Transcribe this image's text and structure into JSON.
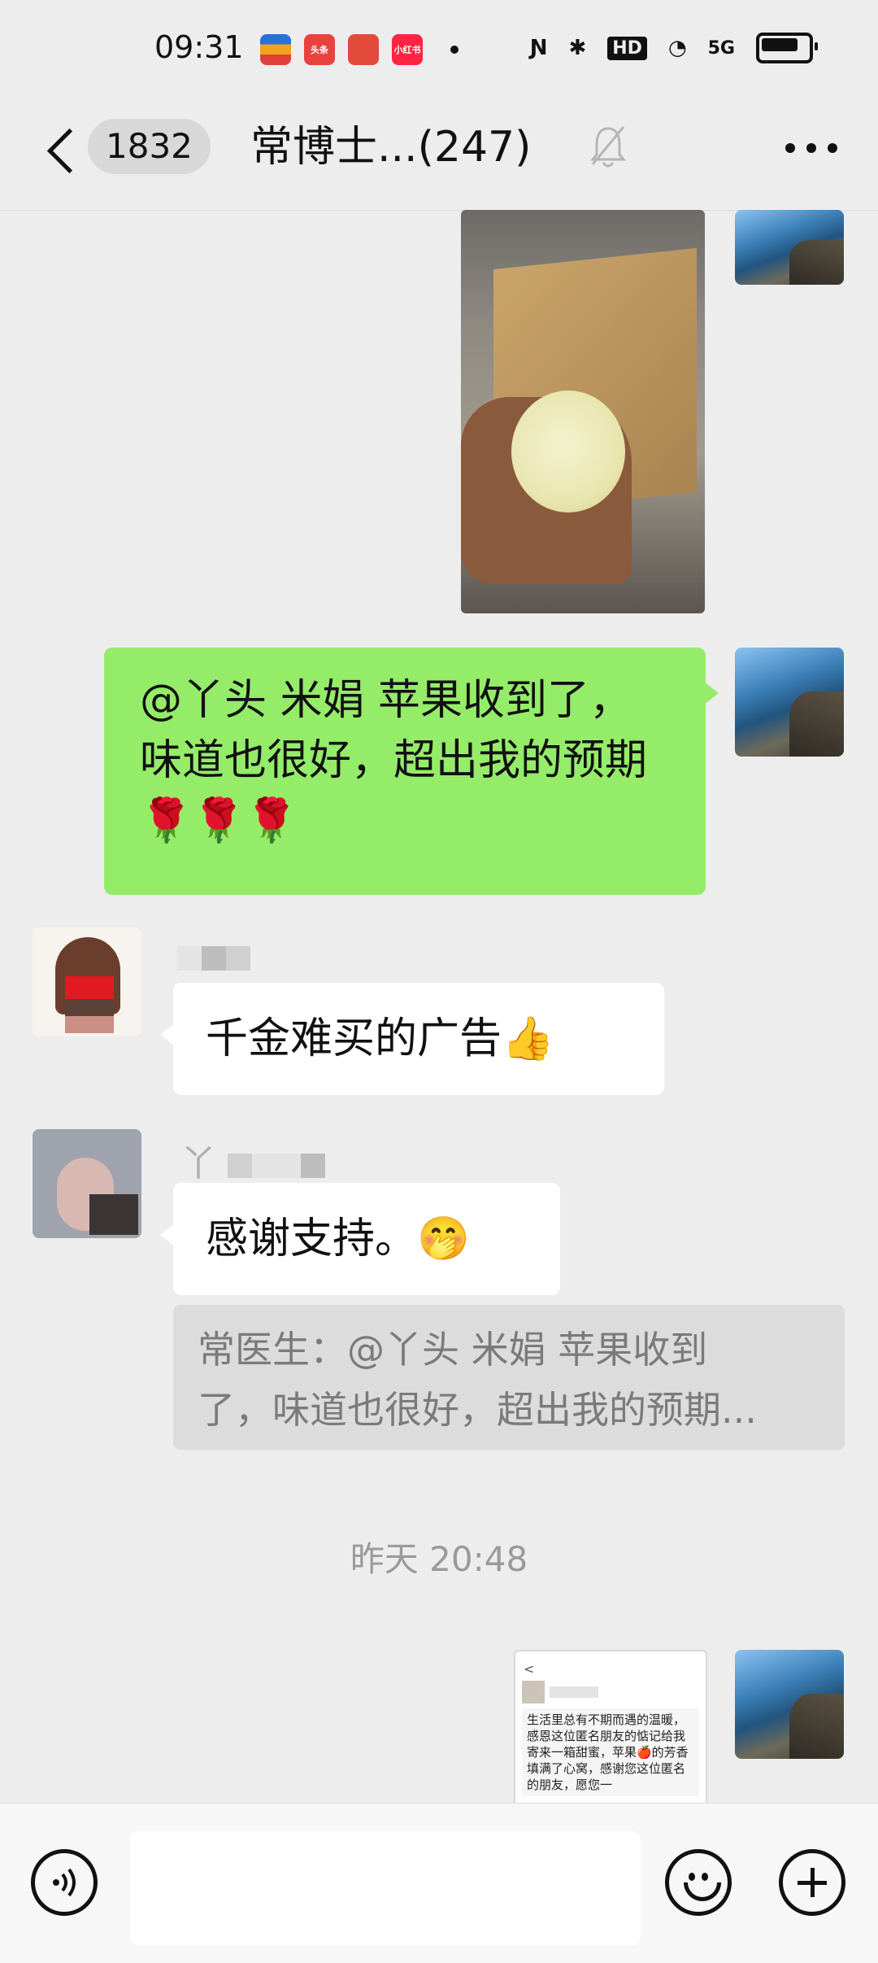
{
  "status_bar": {
    "time": "09:31",
    "network": "5G",
    "hd": "HD",
    "app_badges": [
      "头条",
      "小红书"
    ]
  },
  "header": {
    "unread_count": "1832",
    "title": "常博士...(247)"
  },
  "messages": {
    "my_text": "@丫头 米娟 苹果收到了，味道也很好，超出我的预期🌹🌹🌹",
    "reply_ad": "千金难买的广告👍",
    "sender_2_initial": "丫",
    "reply_thanks": "感谢支持。🤭",
    "quote_line_1": "常医生：@丫头 米娟 苹果收到",
    "quote_line_2": "了，味道也很好，超出我的预期..."
  },
  "timestamp": "昨天 20:48",
  "screenshot_preview": {
    "text": "生活里总有不期而遇的温暖，感恩这位匿名朋友的惦记给我寄来一箱甜蜜，苹果🍎的芳香填满了心窝，感谢您这位匿名的朋友，愿您一"
  },
  "colors": {
    "background": "#ededed",
    "my_bubble": "#95ec69",
    "their_bubble": "#ffffff",
    "quote_bg": "#dcdcdc"
  }
}
